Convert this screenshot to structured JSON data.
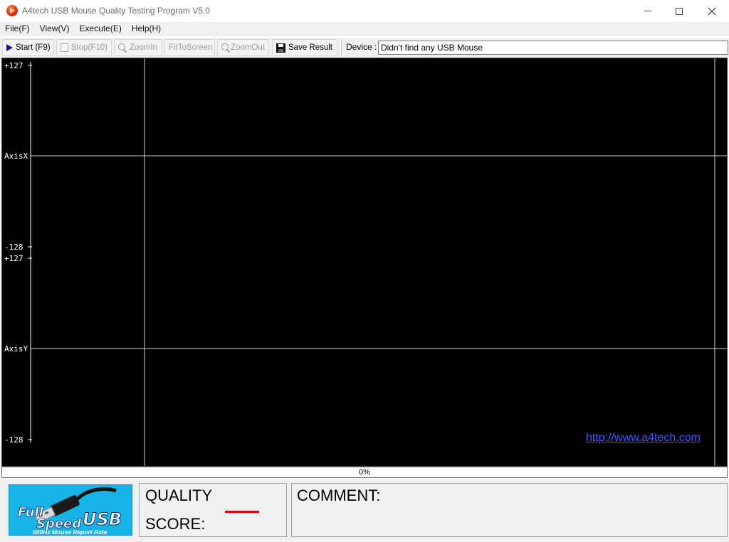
{
  "window": {
    "title": "A4tech USB Mouse Quality Testing Program V5.0"
  },
  "menu": [
    "File(F)",
    "View(V)",
    "Execute(E)",
    "Help(H)"
  ],
  "toolbar": {
    "start": "Start (F9)",
    "stop": "Stop(F10)",
    "zoom_in": "ZoomIn",
    "fit_to_screen": "FitToScreen",
    "zoom_out": "ZoomOut",
    "save_result": "Save Result",
    "device_label": "Device :",
    "device_value": "Didn't find any USB Mouse"
  },
  "graph": {
    "axis_x": {
      "label": "AxisX",
      "max": "+127",
      "min": "-128"
    },
    "axis_y": {
      "label": "AxisY",
      "max": "+127",
      "min": "-128"
    },
    "link": "http://www.a4tech.com"
  },
  "progress": {
    "percent": 0,
    "text": "0%"
  },
  "logo": {
    "line1": "Full",
    "line2": "Speed",
    "line3": "USB",
    "caption": "500Hz Mouse Report Rate"
  },
  "quality_panel": {
    "quality_label": "QUALITY",
    "score_label": "SCORE:"
  },
  "comment_panel": {
    "label": "COMMENT:"
  },
  "colors": {
    "graph_bg": "#000000",
    "score_dash": "#e00000",
    "link": "#3b59ff",
    "logo_bg": "#16b3e6"
  }
}
